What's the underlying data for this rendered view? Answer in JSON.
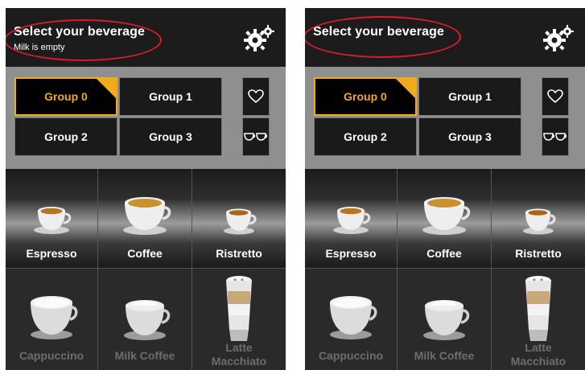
{
  "panels": [
    {
      "title": "Select your beverage",
      "subtitle": "Milk is empty",
      "groups": [
        "Group 0",
        "Group 1",
        "Group 2",
        "Group 3"
      ],
      "beverages": [
        "Espresso",
        "Coffee",
        "Ristretto",
        "Cappuccino",
        "Milk Coffee",
        "Latte\nMacchiato"
      ]
    },
    {
      "title": "Select your beverage",
      "subtitle": "",
      "groups": [
        "Group 0",
        "Group 1",
        "Group 2",
        "Group 3"
      ],
      "beverages": [
        "Espresso",
        "Coffee",
        "Ristretto",
        "Cappuccino",
        "Milk Coffee",
        "Latte\nMacchiato"
      ]
    }
  ],
  "colors": {
    "accent": "#f1a91e",
    "highlight_ring": "#d61c2a",
    "disabled_text": "#6d6d6d"
  },
  "icons": [
    "gear-icon",
    "heart-icon",
    "two-cups-icon"
  ]
}
